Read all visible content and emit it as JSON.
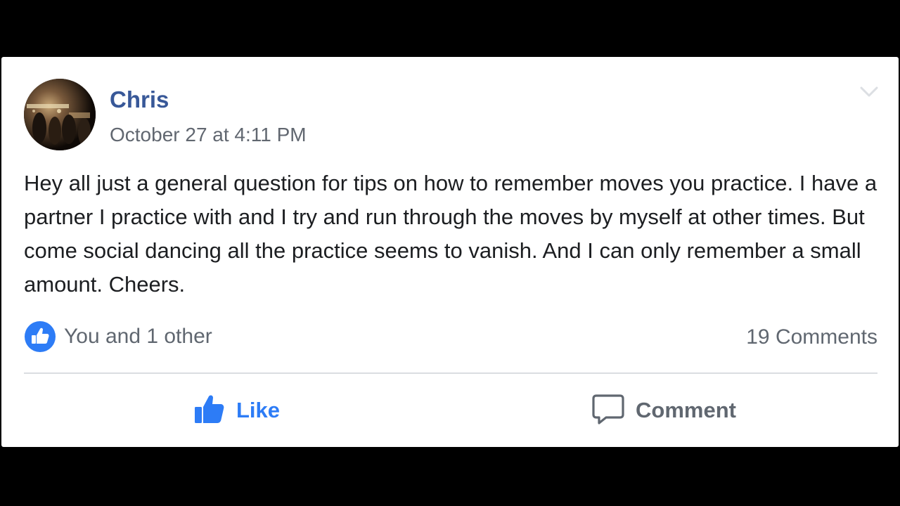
{
  "post": {
    "author": "Chris",
    "timestamp": "October 27 at 4:11 PM",
    "text": "Hey all just a general question for tips on how to remember moves you practice. I have a partner I practice with and I try and run through the moves by myself at other times. But come social dancing all the practice seems to vanish. And I can only remember a small amount. Cheers.",
    "reactions_summary": "You and 1 other",
    "comments_count": "19 Comments"
  },
  "actions": {
    "like_label": "Like",
    "comment_label": "Comment"
  },
  "icons": {
    "avatar": "profile-photo",
    "menu": "chevron-down-icon",
    "reaction": "like-reaction-icon",
    "like": "thumbs-up-icon",
    "comment": "speech-bubble-icon"
  },
  "colors": {
    "author_link": "#385898",
    "like_active": "#2d7cf6",
    "secondary_text": "#606770",
    "body_text": "#1c1e21",
    "letterbox": "#000000"
  }
}
